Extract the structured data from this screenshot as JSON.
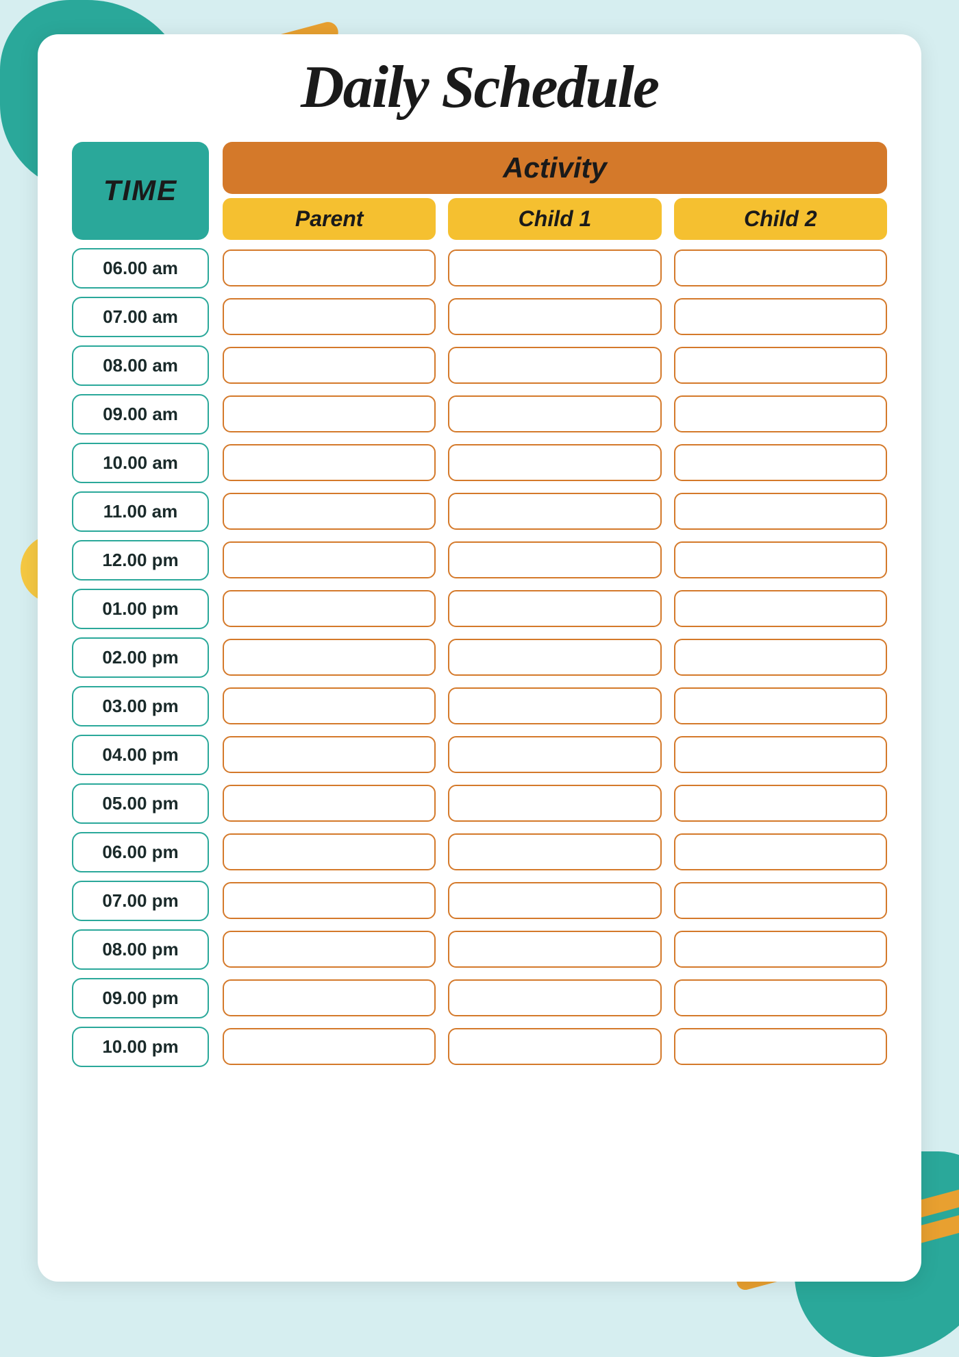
{
  "title": "Daily Schedule",
  "timeHeader": "TIME",
  "activityHeader": "Activity",
  "subHeaders": [
    "Parent",
    "Child 1",
    "Child 2"
  ],
  "times": [
    "06.00 am",
    "07.00 am",
    "08.00 am",
    "09.00 am",
    "10.00 am",
    "11.00 am",
    "12.00 pm",
    "01.00 pm",
    "02.00 pm",
    "03.00 pm",
    "04.00 pm",
    "05.00 pm",
    "06.00 pm",
    "07.00 pm",
    "08.00 pm",
    "09.00 pm",
    "10.00 pm"
  ],
  "colors": {
    "teal": "#2aa89a",
    "orange": "#d4792a",
    "yellow": "#f5c030",
    "background": "#d6eef0"
  }
}
